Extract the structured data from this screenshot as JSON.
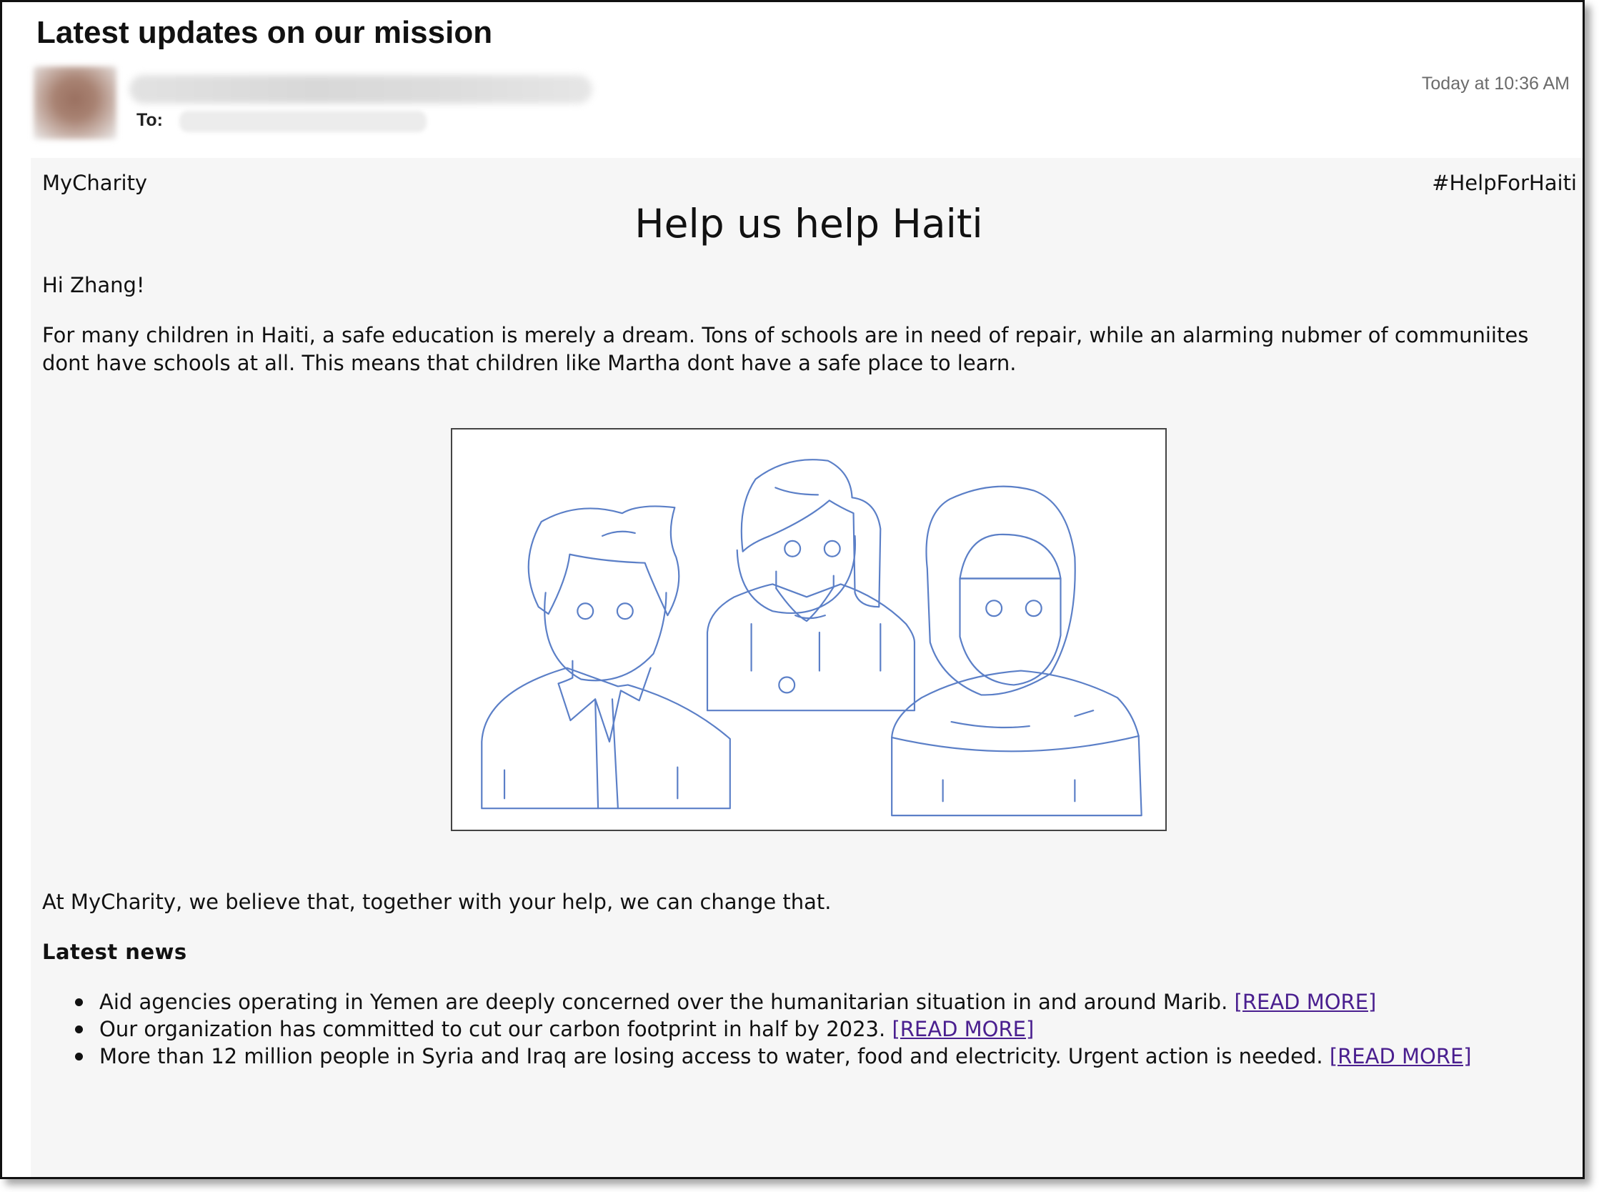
{
  "email": {
    "subject": "Latest updates on our mission",
    "to_label": "To:",
    "timestamp": "Today at 10:36 AM"
  },
  "body": {
    "brand": "MyCharity",
    "hashtag": "#HelpForHaiti",
    "headline": "Help us help Haiti",
    "greeting": "Hi Zhang!",
    "intro": "For many children in Haiti, a safe education is merely a dream. Tons of schools are in need of repair, while an alarming nubmer of communiites dont have schools at all. This means that children like Martha dont have a safe place to learn.",
    "belief": "At MyCharity, we believe that, together with your help, we can change that.",
    "news_heading": "Latest news",
    "news": [
      {
        "text": "Aid agencies operating in Yemen are deeply concerned over the humanitarian situation in and around Marib.",
        "link": "[READ MORE]"
      },
      {
        "text": "Our organization has committed to cut our carbon footprint in half by 2023.",
        "link": "[READ MORE]"
      },
      {
        "text": "More than 12 million people in Syria and Iraq are losing access to water, food and electricity. Urgent action is needed.",
        "link": "[READ MORE]"
      }
    ],
    "colors": {
      "link": "#4a1f8f",
      "illustration_stroke": "#5b7fc7",
      "body_background": "#f6f6f6"
    }
  }
}
